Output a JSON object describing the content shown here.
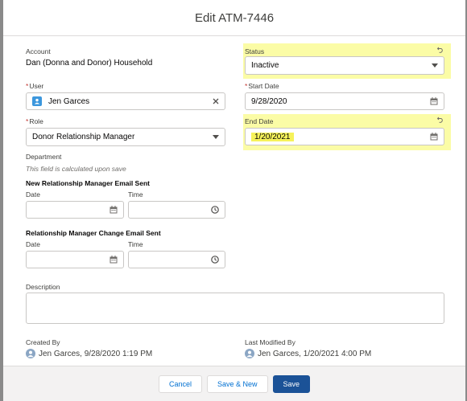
{
  "modal": {
    "title": "Edit ATM-7446"
  },
  "form": {
    "account": {
      "label": "Account",
      "value": "Dan (Donna and Donor) Household"
    },
    "status": {
      "label": "Status",
      "value": "Inactive"
    },
    "user": {
      "label": "User",
      "required": "*",
      "value": "Jen Garces"
    },
    "start_date": {
      "label": "Start Date",
      "required": "*",
      "value": "9/28/2020"
    },
    "role": {
      "label": "Role",
      "required": "*",
      "value": "Donor Relationship Manager"
    },
    "end_date": {
      "label": "End Date",
      "value": "1/20/2021"
    },
    "department": {
      "label": "Department",
      "hint": "This field is calculated upon save"
    },
    "new_rm_email": {
      "title": "New Relationship Manager Email Sent",
      "date_label": "Date",
      "time_label": "Time",
      "date_value": "",
      "time_value": ""
    },
    "rm_change_email": {
      "title": "Relationship Manager Change Email Sent",
      "date_label": "Date",
      "time_label": "Time",
      "date_value": "",
      "time_value": ""
    },
    "description": {
      "label": "Description",
      "value": ""
    },
    "created_by": {
      "label": "Created By",
      "value": "Jen Garces, 9/28/2020 1:19 PM"
    },
    "last_modified_by": {
      "label": "Last Modified By",
      "value": "Jen Garces, 1/20/2021 4:00 PM"
    }
  },
  "footer": {
    "cancel": "Cancel",
    "save_new": "Save & New",
    "save": "Save"
  },
  "colors": {
    "highlight": "#fbfca6",
    "brand": "#1b5297",
    "required": "#c23934"
  }
}
